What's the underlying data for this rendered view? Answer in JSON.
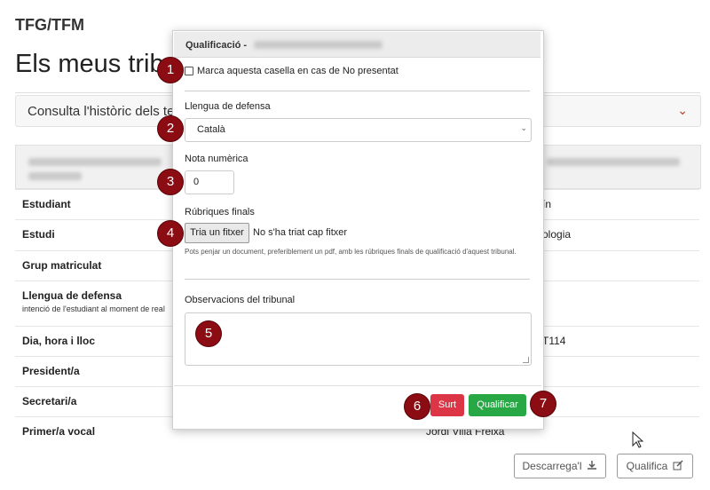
{
  "app": {
    "title": "TFG/TFM"
  },
  "page": {
    "title": "Els meus tribun"
  },
  "history": {
    "label": "Consulta l'històric dels te"
  },
  "rows": [
    {
      "label": "Estudiant",
      "value": "ín"
    },
    {
      "label": "Estudi",
      "value": "ologia"
    },
    {
      "label": "Grup matriculat",
      "value": ""
    },
    {
      "label": "Llengua de defensa",
      "sub": "intenció de l'estudiant al moment de real",
      "value": ""
    },
    {
      "label": "Dia, hora i lloc",
      "value": "T114"
    },
    {
      "label": "President/a",
      "value": ""
    },
    {
      "label": "Secretari/a",
      "value": ""
    },
    {
      "label": "Primer/a vocal",
      "value": "Jordi Villà Freixa"
    }
  ],
  "actions": {
    "download": "Descarrega'l",
    "grade": "Qualifica"
  },
  "modal": {
    "title": "Qualificació -",
    "no_show_label": "Marca aquesta casella en cas de No presentat",
    "language_label": "Llengua de defensa",
    "language_value": "Català",
    "numeric_label": "Nota numèrica",
    "numeric_value": "0",
    "rubrics_label": "Rúbriques finals",
    "file_button": "Tria un fitxer",
    "file_status": "No s'ha triat cap fitxer",
    "help_text": "Pots penjar un document, preferiblement un pdf, amb les rúbriques finals de qualificació d'aquest tribunal.",
    "observations_label": "Observacions del tribunal",
    "exit_button": "Surt",
    "submit_button": "Qualificar"
  },
  "badges": [
    "1",
    "2",
    "3",
    "4",
    "5",
    "6",
    "7"
  ],
  "colors": {
    "badge": "#8b0c12",
    "danger": "#dc3545",
    "success": "#28a745",
    "chevron": "#c0392b"
  }
}
